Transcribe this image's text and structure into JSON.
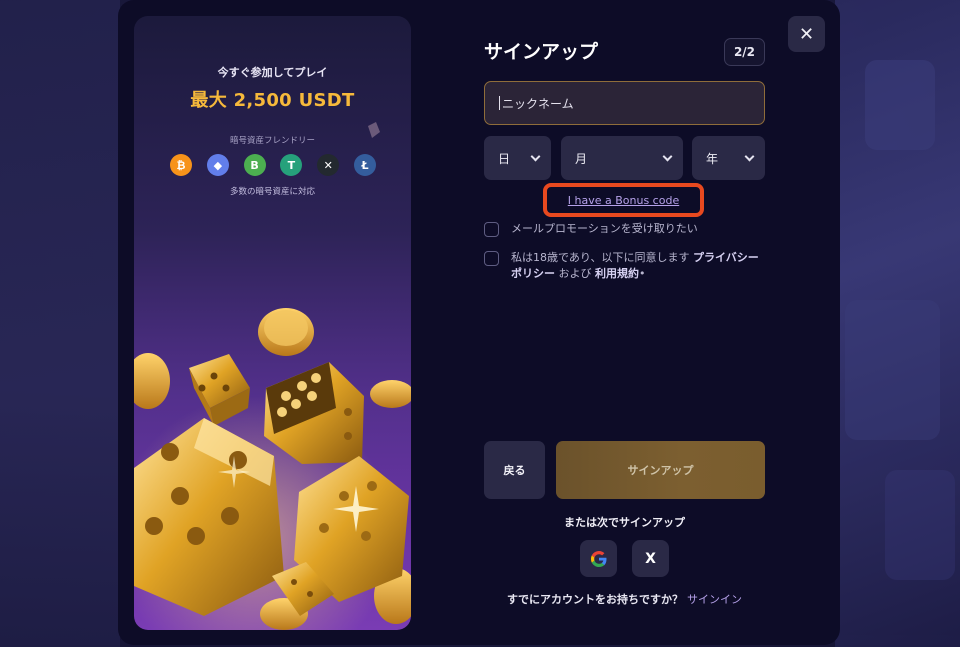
{
  "promo": {
    "subtitle": "今すぐ参加してプレイ",
    "headline": "最大 2,500 USDT",
    "crypto_label": "暗号資産フレンドリー",
    "crypto_sub": "多数の暗号資産に対応",
    "coins": [
      {
        "name": "bitcoin-icon",
        "glyph": "₿",
        "color": "#f7931a"
      },
      {
        "name": "ethereum-icon",
        "glyph": "◆",
        "color": "#627eea"
      },
      {
        "name": "bnb-icon",
        "glyph": "B",
        "color": "#4caf50"
      },
      {
        "name": "tether-icon",
        "glyph": "T",
        "color": "#26a17b"
      },
      {
        "name": "xrp-icon",
        "glyph": "✕",
        "color": "#23292f"
      },
      {
        "name": "litecoin-icon",
        "glyph": "Ł",
        "color": "#345d9d"
      }
    ]
  },
  "form": {
    "title": "サインアップ",
    "step": "2/2",
    "close": "✕",
    "nickname_placeholder": "ニックネーム",
    "day_label": "日",
    "month_label": "月",
    "year_label": "年",
    "bonus_code_link": "I have a Bonus code",
    "email_promo_label": "メールプロモーションを受け取りたい",
    "age_text_prefix": "私は18歳であり、以下に同意します ",
    "privacy_link": "プライバシーポリシー",
    "and_text": " および ",
    "terms_link": "利用規約",
    "terms_suffix": "•",
    "back_label": "戻る",
    "signup_label": "サインアップ",
    "or_label": "または次でサインアップ",
    "google_label": "G",
    "x_label": "X",
    "have_account": "すでにアカウントをお持ちですか？",
    "signin_link": "サインイン"
  },
  "colors": {
    "accent_gold": "#f6b93b",
    "link_purple": "#b6a2ea",
    "highlight_red": "#e8491f"
  }
}
